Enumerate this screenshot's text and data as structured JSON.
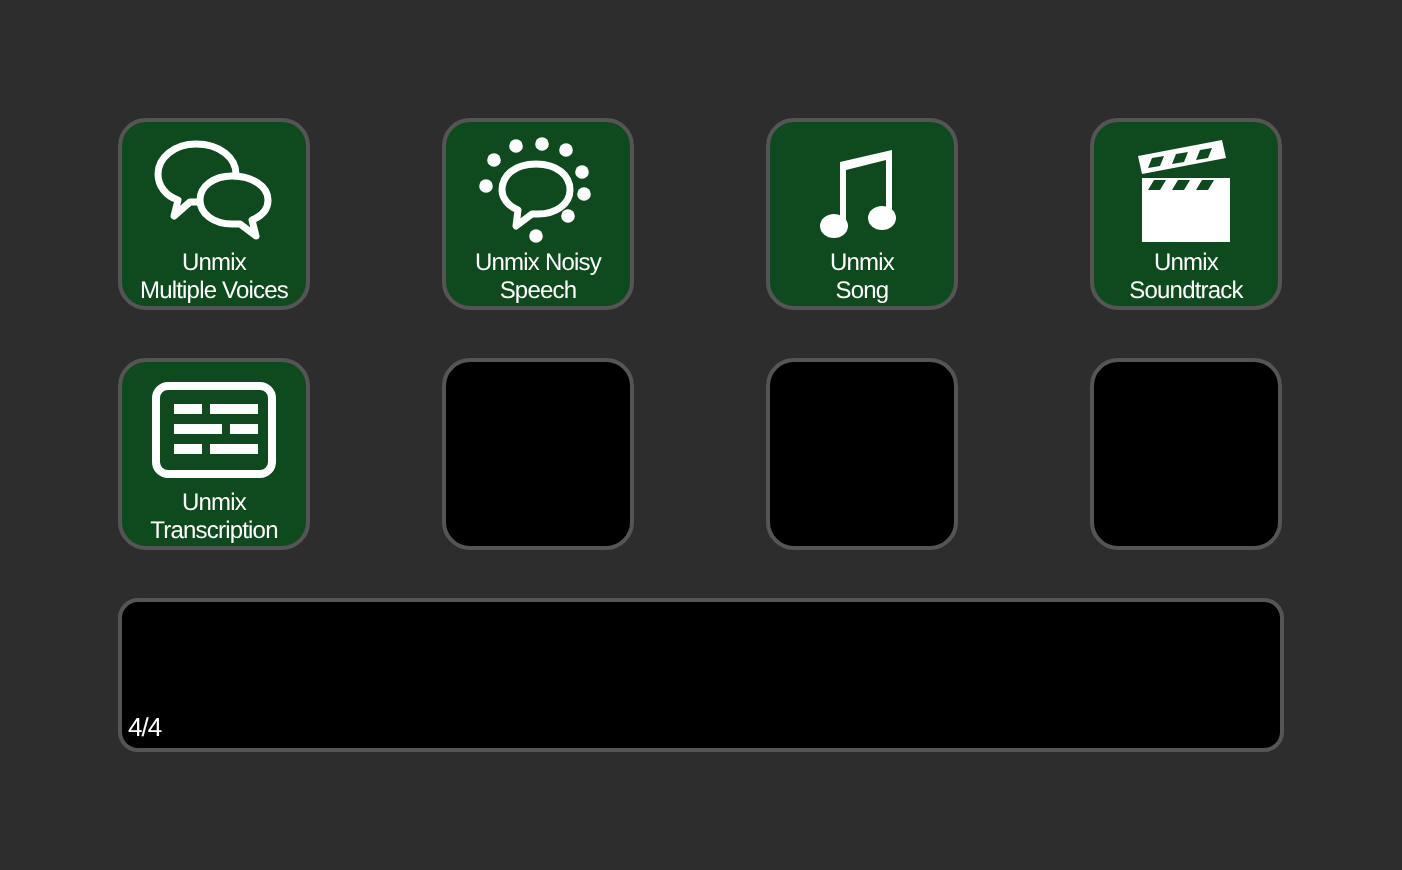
{
  "keys": [
    {
      "kind": "action",
      "label_lines": [
        "Unmix",
        "Multiple Voices"
      ]
    },
    {
      "kind": "action",
      "label_lines": [
        "Unmix Noisy",
        "Speech"
      ]
    },
    {
      "kind": "action",
      "label_lines": [
        "Unmix",
        "Song"
      ]
    },
    {
      "kind": "action",
      "label_lines": [
        "Unmix",
        "Soundtrack"
      ]
    },
    {
      "kind": "action",
      "label_lines": [
        "Unmix",
        "Transcription"
      ]
    },
    {
      "kind": "empty"
    },
    {
      "kind": "empty"
    },
    {
      "kind": "empty"
    }
  ],
  "display": {
    "page": "4/4"
  }
}
